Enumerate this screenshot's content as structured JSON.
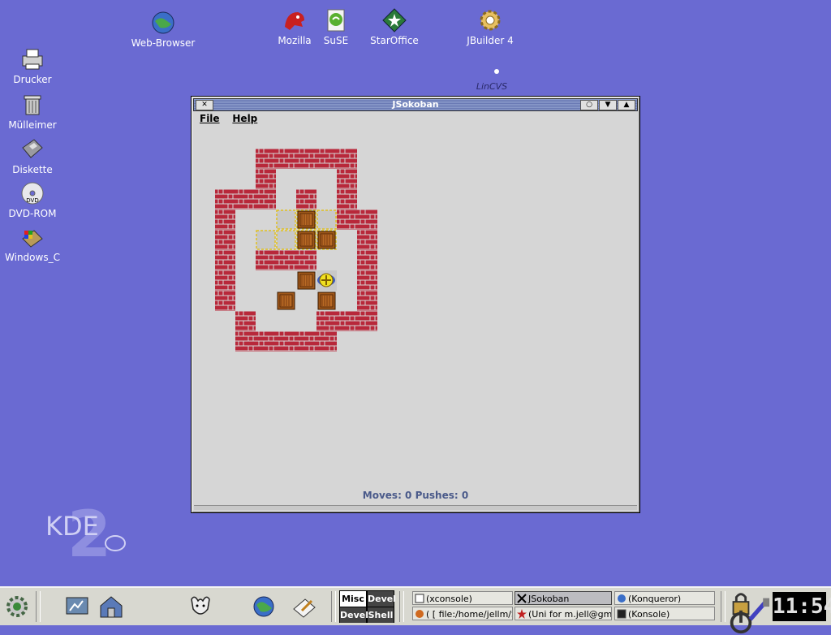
{
  "desktop": {
    "icons": [
      {
        "label": "Web-Browser",
        "icon": "globe-icon"
      },
      {
        "label": "Mozilla",
        "icon": "mozilla-icon"
      },
      {
        "label": "SuSE",
        "icon": "suse-icon"
      },
      {
        "label": "StarOffice",
        "icon": "staroffice-icon"
      },
      {
        "label": "JBuilder 4",
        "icon": "gear-icon"
      },
      {
        "label": "LinCVS",
        "icon": "lincvs-icon"
      },
      {
        "label": "Drucker",
        "icon": "printer-icon"
      },
      {
        "label": "Mülleimer",
        "icon": "trash-icon"
      },
      {
        "label": "Diskette",
        "icon": "floppy-icon"
      },
      {
        "label": "DVD-ROM",
        "icon": "dvd-icon"
      },
      {
        "label": "Windows_C",
        "icon": "windows-drive-icon"
      }
    ],
    "logo_text": "KDE",
    "logo_number": "2"
  },
  "window": {
    "title": "JSokoban",
    "menu": [
      "File",
      "Help"
    ],
    "status": "Moves: 0 Pushes: 0",
    "colors": {
      "wall": "#b8283a",
      "floor": "#d6d6d6",
      "crate": "#a0581a",
      "goal": "#e0c020"
    }
  },
  "panel": {
    "desktops": [
      "Misc",
      "Devel",
      "Devel",
      "Shell"
    ],
    "tasks": [
      {
        "label": "(xconsole)",
        "icon": "console-icon"
      },
      {
        "label": "JSokoban",
        "icon": "x-icon",
        "active": true
      },
      {
        "label": "(Konqueror)",
        "icon": "konqueror-icon"
      },
      {
        "label": "( [ file:/home/jellm/So",
        "icon": "konqueror-icon"
      },
      {
        "label": "(Uni for m.jell@gmx",
        "icon": "star-icon"
      },
      {
        "label": "(Konsole)",
        "icon": "konsole-icon"
      }
    ],
    "clock": "11:54"
  }
}
